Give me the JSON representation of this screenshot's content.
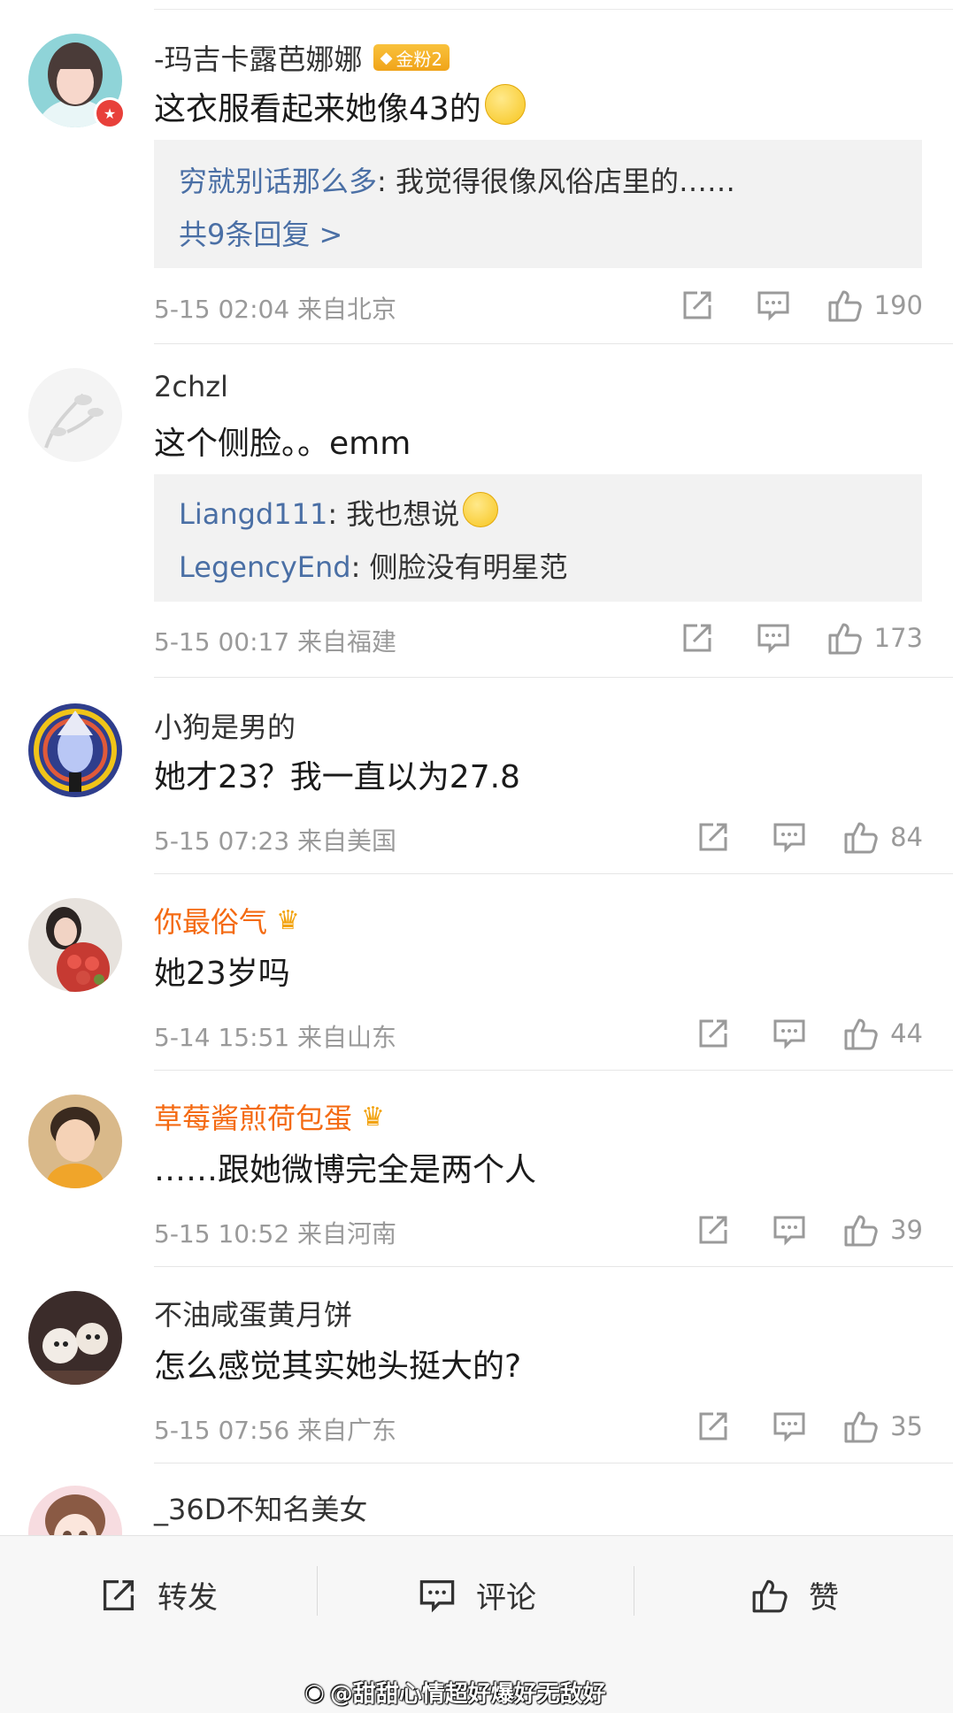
{
  "comments": [
    {
      "name": "-玛吉卡露芭娜娜",
      "badge": "金粉2",
      "text": "这衣服看起来她像43的",
      "replies": [
        {
          "user": "穷就别话那么多",
          "text": ": 我觉得很像风俗店里的……"
        }
      ],
      "more": "共9条回复 >",
      "time": "5-15 02:04",
      "location": "来自北京",
      "likes": "190"
    },
    {
      "name": "2chzl",
      "text": "这个侧脸。。emm",
      "replies": [
        {
          "user": "Liangd111",
          "text": ": 我也想说"
        },
        {
          "user": "LegencyEnd",
          "text": ": 侧脸没有明星范"
        }
      ],
      "time": "5-15 00:17",
      "location": "来自福建",
      "likes": "173"
    },
    {
      "name": "小狗是男的",
      "text": "她才23？我一直以为27.8",
      "time": "5-15 07:23",
      "location": "来自美国",
      "likes": "84"
    },
    {
      "name": "你最俗气",
      "text": "她23岁吗",
      "time": "5-14 15:51",
      "location": "来自山东",
      "likes": "44"
    },
    {
      "name": "草莓酱煎荷包蛋",
      "text": "……跟她微博完全是两个人",
      "time": "5-15 10:52",
      "location": "来自河南",
      "likes": "39"
    },
    {
      "name": "不油咸蛋黄月饼",
      "text": "怎么感觉其实她头挺大的?",
      "time": "5-15 07:56",
      "location": "来自广东",
      "likes": "35"
    },
    {
      "name": "_36D不知名美女"
    }
  ],
  "toolbar": {
    "repost_label": "转发",
    "comment_label": "评论",
    "like_label": "赞"
  },
  "watermark": "@甜甜心情超好爆好无敌好",
  "colors": {
    "link": "#4a6fa5",
    "vip_name": "#f46a12",
    "meta": "#9a9a9a",
    "reply_bg": "#f2f2f2"
  }
}
